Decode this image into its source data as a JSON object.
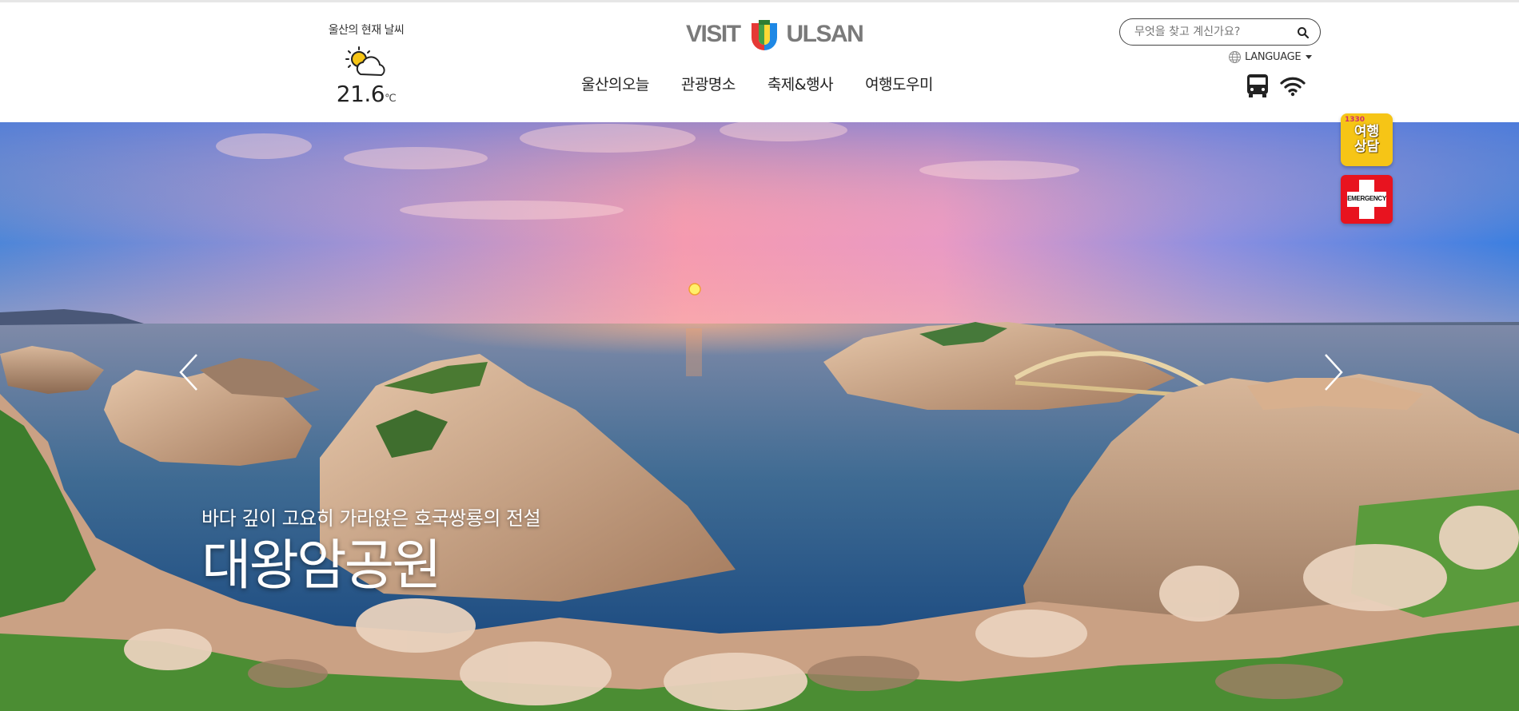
{
  "weather": {
    "label": "울산의 현재 날씨",
    "icon": "partly-cloudy-icon",
    "temperature": "21.6",
    "unit": "℃"
  },
  "logo": {
    "left_text": "VISIT",
    "right_text": "ULSAN",
    "mark_colors": [
      "#e53935",
      "#43a047",
      "#1e88e5",
      "#fdd835"
    ]
  },
  "nav": {
    "items": [
      {
        "label": "울산의오늘"
      },
      {
        "label": "관광명소"
      },
      {
        "label": "축제&행사"
      },
      {
        "label": "여행도우미"
      }
    ]
  },
  "search": {
    "placeholder": "무엇을 찾고 계신가요?",
    "value": "",
    "icon": "search-icon"
  },
  "language": {
    "label": "LANGUAGE",
    "icon": "globe-icon"
  },
  "utility_icons": [
    "bus-icon",
    "wifi-icon"
  ],
  "hero": {
    "subtitle": "바다 깊이 고요히 가라앉은 호국쌍룡의 전설",
    "title": "대왕암공원"
  },
  "quick_links": {
    "consult": {
      "number": "1330",
      "label": "여행\n상담",
      "color": "#f6c516"
    },
    "emergency": {
      "label": "EMERGENCY",
      "color": "#e8131f"
    }
  }
}
